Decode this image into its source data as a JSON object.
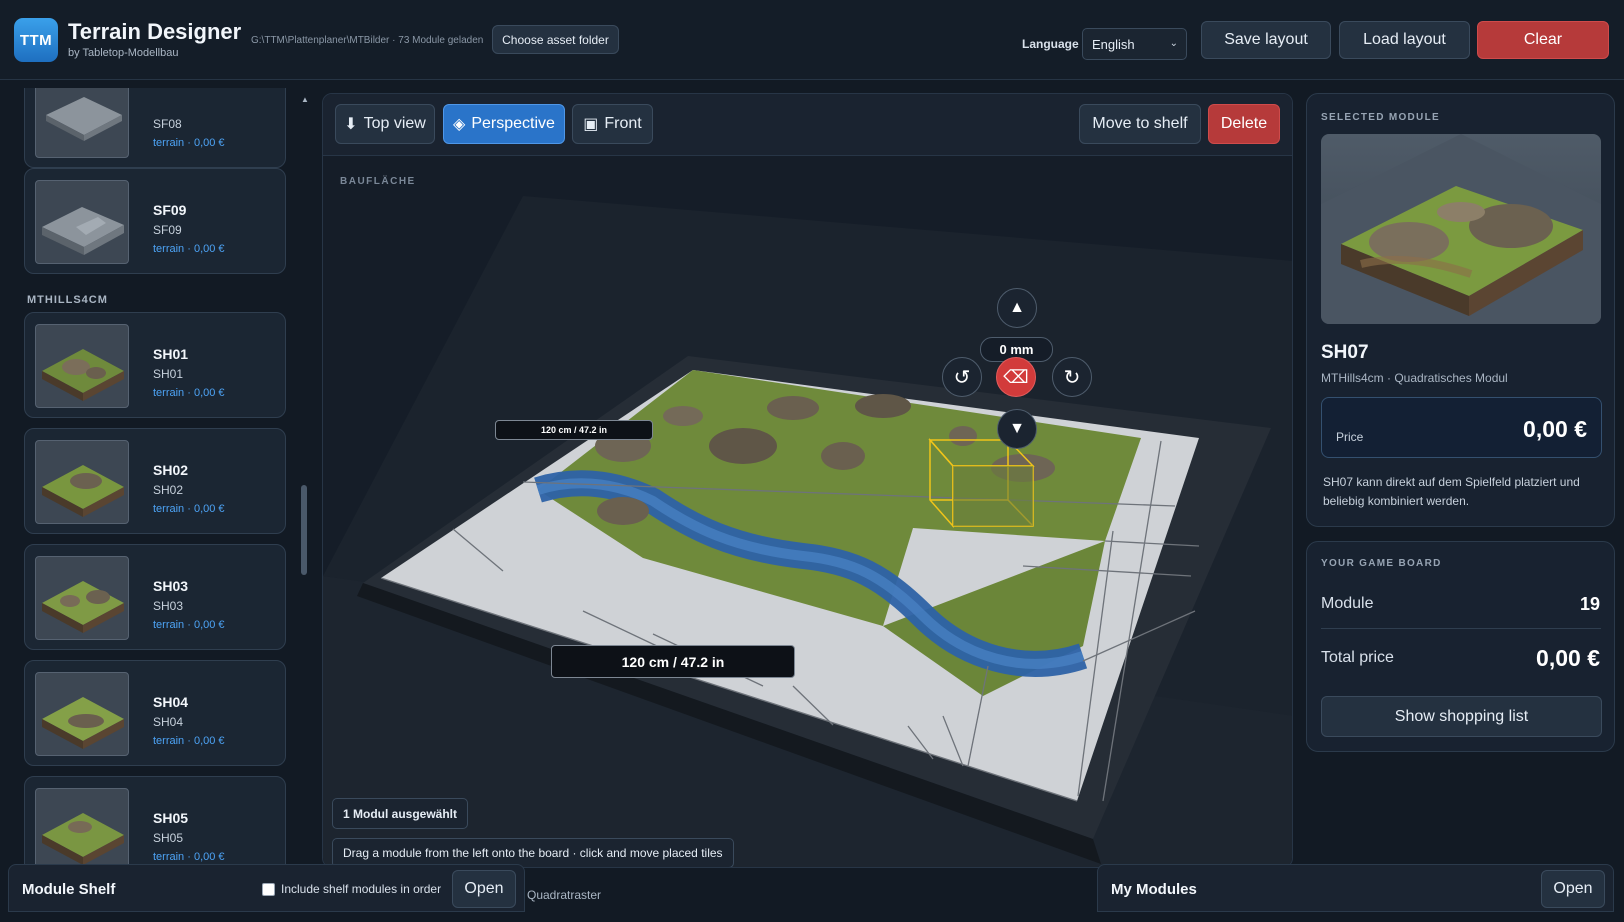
{
  "header": {
    "logo_text": "TTM",
    "title": "Terrain Designer",
    "subtitle": "by Tabletop-Modellbau",
    "asset_path": "G:\\TTM\\Plattenplaner\\MTBilder · 73 Module geladen",
    "choose_folder_label": "Choose asset folder",
    "language_label": "Language",
    "language_value": "English",
    "save_label": "Save layout",
    "load_label": "Load layout",
    "clear_label": "Clear"
  },
  "library": {
    "category": "MTHILLS4CM",
    "items": [
      {
        "name": "",
        "code": "SF08",
        "meta": "terrain · 0,00 €"
      },
      {
        "name": "SF09",
        "code": "SF09",
        "meta": "terrain · 0,00 €"
      },
      {
        "name": "SH01",
        "code": "SH01",
        "meta": "terrain · 0,00 €"
      },
      {
        "name": "SH02",
        "code": "SH02",
        "meta": "terrain · 0,00 €"
      },
      {
        "name": "SH03",
        "code": "SH03",
        "meta": "terrain · 0,00 €"
      },
      {
        "name": "SH04",
        "code": "SH04",
        "meta": "terrain · 0,00 €"
      },
      {
        "name": "SH05",
        "code": "SH05",
        "meta": "terrain · 0,00 €"
      }
    ]
  },
  "viewport": {
    "top_view_label": "Top view",
    "perspective_label": "Perspective",
    "front_label": "Front",
    "active_view": "Perspective",
    "move_to_shelf_label": "Move to shelf",
    "delete_label": "Delete",
    "area_label": "BAUFLÄCHE",
    "dim_small": "120 cm / 47.2 in",
    "dim_large": "120 cm / 47.2 in",
    "height_value": "0 mm",
    "selection_status": "1 Modul ausgewählt",
    "hint": "Drag a module from the left onto the board · click and move placed tiles",
    "grid_label": "Quadratraster"
  },
  "selected": {
    "title": "SELECTED MODULE",
    "name": "SH07",
    "meta": "MTHills4cm · Quadratisches Modul",
    "price_label": "Price",
    "price_value": "0,00 €",
    "description": "SH07 kann direkt auf dem Spielfeld platziert und beliebig kombiniert werden."
  },
  "board": {
    "title": "YOUR GAME BOARD",
    "module_label": "Module",
    "module_count": "19",
    "total_label": "Total price",
    "total_value": "0,00 €",
    "shopping_label": "Show shopping list"
  },
  "shelf": {
    "title": "Module Shelf",
    "include_label": "Include shelf modules in order",
    "include_checked": false,
    "open_label": "Open"
  },
  "my_modules": {
    "title": "My Modules",
    "open_label": "Open"
  },
  "colors": {
    "accent": "#2a74c9",
    "danger": "#b63a3a",
    "link": "#4da3f5",
    "selection": "#f0c419"
  }
}
